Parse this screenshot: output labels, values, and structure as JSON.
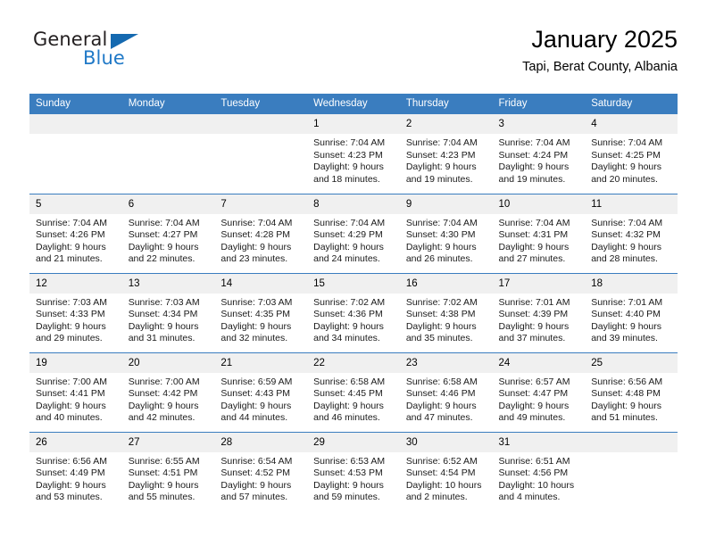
{
  "brand": {
    "line1": "General",
    "line2": "Blue",
    "flag_icon": "triangle-flag-icon",
    "accent_color": "#1569b0"
  },
  "header": {
    "title": "January 2025",
    "subtitle": "Tapi, Berat County, Albania"
  },
  "theme": {
    "header_bg": "#3a7dbf",
    "date_band_bg": "#f0f0f0",
    "row_divider": "#3a7dbf",
    "text": "#000000"
  },
  "weekday_headers": [
    "Sunday",
    "Monday",
    "Tuesday",
    "Wednesday",
    "Thursday",
    "Friday",
    "Saturday"
  ],
  "weeks": [
    [
      {
        "date": "",
        "empty": true,
        "sunrise": "",
        "sunset": "",
        "daylight_line1": "",
        "daylight_line2": ""
      },
      {
        "date": "",
        "empty": true,
        "sunrise": "",
        "sunset": "",
        "daylight_line1": "",
        "daylight_line2": ""
      },
      {
        "date": "",
        "empty": true,
        "sunrise": "",
        "sunset": "",
        "daylight_line1": "",
        "daylight_line2": ""
      },
      {
        "date": "1",
        "empty": false,
        "sunrise": "Sunrise: 7:04 AM",
        "sunset": "Sunset: 4:23 PM",
        "daylight_line1": "Daylight: 9 hours",
        "daylight_line2": "and 18 minutes."
      },
      {
        "date": "2",
        "empty": false,
        "sunrise": "Sunrise: 7:04 AM",
        "sunset": "Sunset: 4:23 PM",
        "daylight_line1": "Daylight: 9 hours",
        "daylight_line2": "and 19 minutes."
      },
      {
        "date": "3",
        "empty": false,
        "sunrise": "Sunrise: 7:04 AM",
        "sunset": "Sunset: 4:24 PM",
        "daylight_line1": "Daylight: 9 hours",
        "daylight_line2": "and 19 minutes."
      },
      {
        "date": "4",
        "empty": false,
        "sunrise": "Sunrise: 7:04 AM",
        "sunset": "Sunset: 4:25 PM",
        "daylight_line1": "Daylight: 9 hours",
        "daylight_line2": "and 20 minutes."
      }
    ],
    [
      {
        "date": "5",
        "empty": false,
        "sunrise": "Sunrise: 7:04 AM",
        "sunset": "Sunset: 4:26 PM",
        "daylight_line1": "Daylight: 9 hours",
        "daylight_line2": "and 21 minutes."
      },
      {
        "date": "6",
        "empty": false,
        "sunrise": "Sunrise: 7:04 AM",
        "sunset": "Sunset: 4:27 PM",
        "daylight_line1": "Daylight: 9 hours",
        "daylight_line2": "and 22 minutes."
      },
      {
        "date": "7",
        "empty": false,
        "sunrise": "Sunrise: 7:04 AM",
        "sunset": "Sunset: 4:28 PM",
        "daylight_line1": "Daylight: 9 hours",
        "daylight_line2": "and 23 minutes."
      },
      {
        "date": "8",
        "empty": false,
        "sunrise": "Sunrise: 7:04 AM",
        "sunset": "Sunset: 4:29 PM",
        "daylight_line1": "Daylight: 9 hours",
        "daylight_line2": "and 24 minutes."
      },
      {
        "date": "9",
        "empty": false,
        "sunrise": "Sunrise: 7:04 AM",
        "sunset": "Sunset: 4:30 PM",
        "daylight_line1": "Daylight: 9 hours",
        "daylight_line2": "and 26 minutes."
      },
      {
        "date": "10",
        "empty": false,
        "sunrise": "Sunrise: 7:04 AM",
        "sunset": "Sunset: 4:31 PM",
        "daylight_line1": "Daylight: 9 hours",
        "daylight_line2": "and 27 minutes."
      },
      {
        "date": "11",
        "empty": false,
        "sunrise": "Sunrise: 7:04 AM",
        "sunset": "Sunset: 4:32 PM",
        "daylight_line1": "Daylight: 9 hours",
        "daylight_line2": "and 28 minutes."
      }
    ],
    [
      {
        "date": "12",
        "empty": false,
        "sunrise": "Sunrise: 7:03 AM",
        "sunset": "Sunset: 4:33 PM",
        "daylight_line1": "Daylight: 9 hours",
        "daylight_line2": "and 29 minutes."
      },
      {
        "date": "13",
        "empty": false,
        "sunrise": "Sunrise: 7:03 AM",
        "sunset": "Sunset: 4:34 PM",
        "daylight_line1": "Daylight: 9 hours",
        "daylight_line2": "and 31 minutes."
      },
      {
        "date": "14",
        "empty": false,
        "sunrise": "Sunrise: 7:03 AM",
        "sunset": "Sunset: 4:35 PM",
        "daylight_line1": "Daylight: 9 hours",
        "daylight_line2": "and 32 minutes."
      },
      {
        "date": "15",
        "empty": false,
        "sunrise": "Sunrise: 7:02 AM",
        "sunset": "Sunset: 4:36 PM",
        "daylight_line1": "Daylight: 9 hours",
        "daylight_line2": "and 34 minutes."
      },
      {
        "date": "16",
        "empty": false,
        "sunrise": "Sunrise: 7:02 AM",
        "sunset": "Sunset: 4:38 PM",
        "daylight_line1": "Daylight: 9 hours",
        "daylight_line2": "and 35 minutes."
      },
      {
        "date": "17",
        "empty": false,
        "sunrise": "Sunrise: 7:01 AM",
        "sunset": "Sunset: 4:39 PM",
        "daylight_line1": "Daylight: 9 hours",
        "daylight_line2": "and 37 minutes."
      },
      {
        "date": "18",
        "empty": false,
        "sunrise": "Sunrise: 7:01 AM",
        "sunset": "Sunset: 4:40 PM",
        "daylight_line1": "Daylight: 9 hours",
        "daylight_line2": "and 39 minutes."
      }
    ],
    [
      {
        "date": "19",
        "empty": false,
        "sunrise": "Sunrise: 7:00 AM",
        "sunset": "Sunset: 4:41 PM",
        "daylight_line1": "Daylight: 9 hours",
        "daylight_line2": "and 40 minutes."
      },
      {
        "date": "20",
        "empty": false,
        "sunrise": "Sunrise: 7:00 AM",
        "sunset": "Sunset: 4:42 PM",
        "daylight_line1": "Daylight: 9 hours",
        "daylight_line2": "and 42 minutes."
      },
      {
        "date": "21",
        "empty": false,
        "sunrise": "Sunrise: 6:59 AM",
        "sunset": "Sunset: 4:43 PM",
        "daylight_line1": "Daylight: 9 hours",
        "daylight_line2": "and 44 minutes."
      },
      {
        "date": "22",
        "empty": false,
        "sunrise": "Sunrise: 6:58 AM",
        "sunset": "Sunset: 4:45 PM",
        "daylight_line1": "Daylight: 9 hours",
        "daylight_line2": "and 46 minutes."
      },
      {
        "date": "23",
        "empty": false,
        "sunrise": "Sunrise: 6:58 AM",
        "sunset": "Sunset: 4:46 PM",
        "daylight_line1": "Daylight: 9 hours",
        "daylight_line2": "and 47 minutes."
      },
      {
        "date": "24",
        "empty": false,
        "sunrise": "Sunrise: 6:57 AM",
        "sunset": "Sunset: 4:47 PM",
        "daylight_line1": "Daylight: 9 hours",
        "daylight_line2": "and 49 minutes."
      },
      {
        "date": "25",
        "empty": false,
        "sunrise": "Sunrise: 6:56 AM",
        "sunset": "Sunset: 4:48 PM",
        "daylight_line1": "Daylight: 9 hours",
        "daylight_line2": "and 51 minutes."
      }
    ],
    [
      {
        "date": "26",
        "empty": false,
        "sunrise": "Sunrise: 6:56 AM",
        "sunset": "Sunset: 4:49 PM",
        "daylight_line1": "Daylight: 9 hours",
        "daylight_line2": "and 53 minutes."
      },
      {
        "date": "27",
        "empty": false,
        "sunrise": "Sunrise: 6:55 AM",
        "sunset": "Sunset: 4:51 PM",
        "daylight_line1": "Daylight: 9 hours",
        "daylight_line2": "and 55 minutes."
      },
      {
        "date": "28",
        "empty": false,
        "sunrise": "Sunrise: 6:54 AM",
        "sunset": "Sunset: 4:52 PM",
        "daylight_line1": "Daylight: 9 hours",
        "daylight_line2": "and 57 minutes."
      },
      {
        "date": "29",
        "empty": false,
        "sunrise": "Sunrise: 6:53 AM",
        "sunset": "Sunset: 4:53 PM",
        "daylight_line1": "Daylight: 9 hours",
        "daylight_line2": "and 59 minutes."
      },
      {
        "date": "30",
        "empty": false,
        "sunrise": "Sunrise: 6:52 AM",
        "sunset": "Sunset: 4:54 PM",
        "daylight_line1": "Daylight: 10 hours",
        "daylight_line2": "and 2 minutes."
      },
      {
        "date": "31",
        "empty": false,
        "sunrise": "Sunrise: 6:51 AM",
        "sunset": "Sunset: 4:56 PM",
        "daylight_line1": "Daylight: 10 hours",
        "daylight_line2": "and 4 minutes."
      },
      {
        "date": "",
        "empty": true,
        "sunrise": "",
        "sunset": "",
        "daylight_line1": "",
        "daylight_line2": ""
      }
    ]
  ]
}
